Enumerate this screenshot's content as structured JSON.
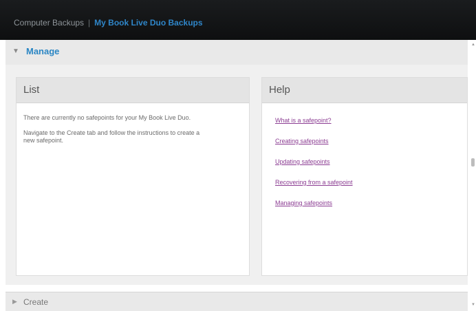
{
  "breadcrumb": {
    "root": "Computer Backups",
    "separator": "|",
    "current": "My Book Live Duo Backups"
  },
  "manage": {
    "title": "Manage",
    "expand_icon": "triangle-down-icon"
  },
  "list_panel": {
    "title": "List",
    "paragraphs": [
      "There are currently no safepoints for your My Book Live Duo.",
      "Navigate to the Create tab and follow the instructions to create a new safepoint."
    ]
  },
  "help_panel": {
    "title": "Help",
    "links": [
      "What is a safepoint?",
      "Creating safepoints",
      "Updating safepoints",
      "Recovering from a safepoint",
      "Managing safepoints"
    ]
  },
  "create": {
    "title": "Create",
    "expand_icon": "triangle-right-icon"
  },
  "colors": {
    "accent": "#2f86c9",
    "link": "#8b3c92",
    "topbar": "#111213"
  }
}
